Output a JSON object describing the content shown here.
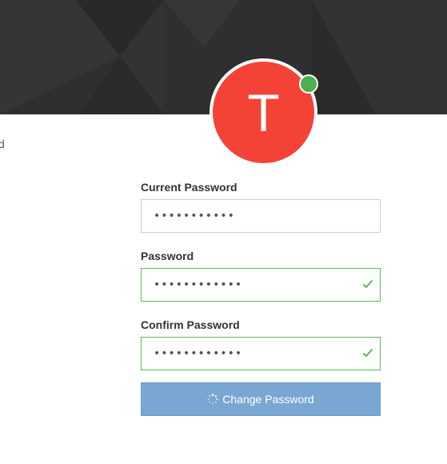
{
  "header": {
    "avatar_initial": "T",
    "presence": "online"
  },
  "side_text": "d",
  "form": {
    "current_password": {
      "label": "Current Password",
      "value": "•••••••••••",
      "state": "default"
    },
    "password": {
      "label": "Password",
      "value": "••••••••••••",
      "state": "valid"
    },
    "confirm_password": {
      "label": "Confirm Password",
      "value": "••••••••••••",
      "state": "valid"
    },
    "submit_label": "Change Password",
    "submit_state": "loading"
  },
  "colors": {
    "banner": "#2f2f2f",
    "avatar": "#f44336",
    "presence": "#4caf50",
    "valid_border": "#5cb85c",
    "button": "#7aa7d2"
  },
  "icons": [
    "check-icon",
    "spinner-icon"
  ]
}
